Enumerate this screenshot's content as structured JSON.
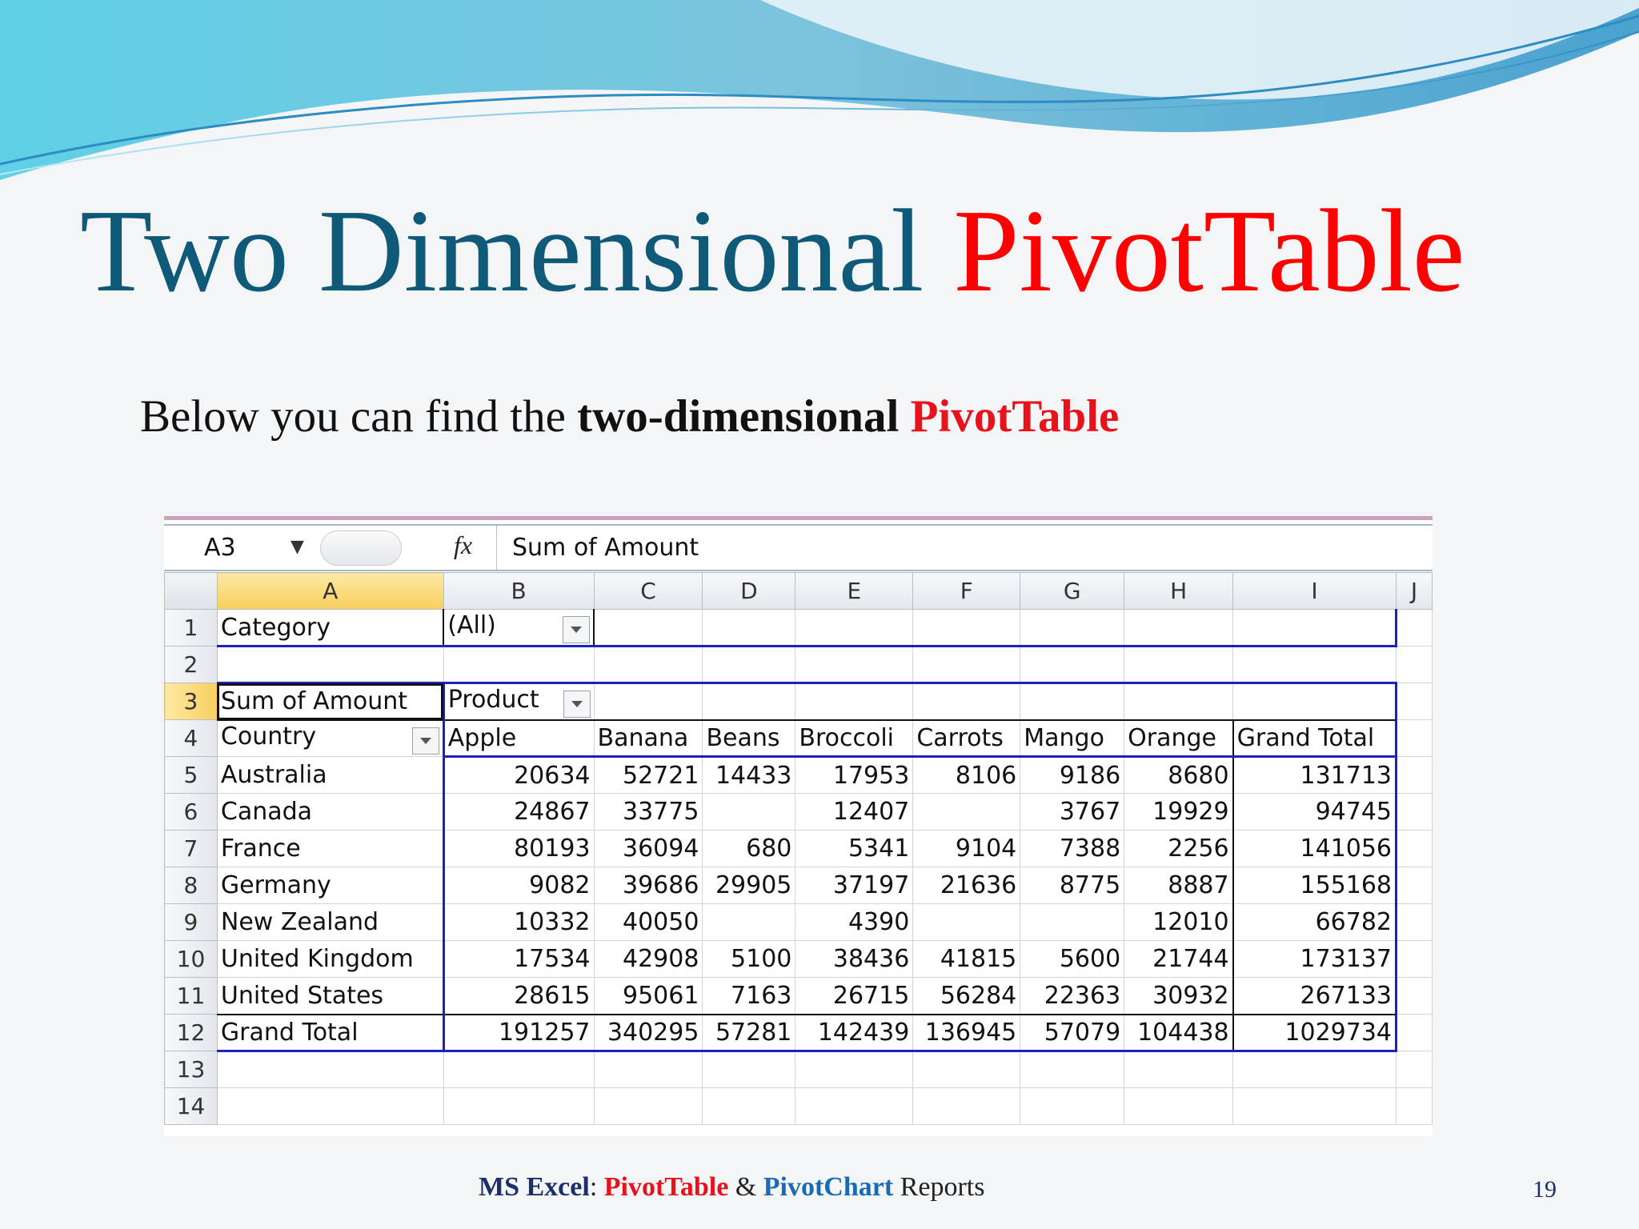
{
  "slide": {
    "title_part1": "Two Dimensional ",
    "title_part2": "PivotTable",
    "subtitle_part1": "Below you can find the ",
    "subtitle_bold": "two-dimensional ",
    "subtitle_red": "PivotTable"
  },
  "excel": {
    "name_box": "A3",
    "formula": "Sum of Amount",
    "fx_label": "fx",
    "columns": [
      "A",
      "B",
      "C",
      "D",
      "E",
      "F",
      "G",
      "H",
      "I",
      "J"
    ],
    "row_numbers": [
      "1",
      "2",
      "3",
      "4",
      "5",
      "6",
      "7",
      "8",
      "9",
      "10",
      "11",
      "12",
      "13",
      "14"
    ],
    "filter_label": "Category",
    "filter_value": "(All)",
    "values_label": "Sum of Amount",
    "col_field": "Product",
    "row_field": "Country",
    "products": [
      "Apple",
      "Banana",
      "Beans",
      "Broccoli",
      "Carrots",
      "Mango",
      "Orange",
      "Grand Total"
    ],
    "rows": [
      {
        "country": "Australia",
        "values": [
          "20634",
          "52721",
          "14433",
          "17953",
          "8106",
          "9186",
          "8680",
          "131713"
        ]
      },
      {
        "country": "Canada",
        "values": [
          "24867",
          "33775",
          "",
          "12407",
          "",
          "3767",
          "19929",
          "94745"
        ]
      },
      {
        "country": "France",
        "values": [
          "80193",
          "36094",
          "680",
          "5341",
          "9104",
          "7388",
          "2256",
          "141056"
        ]
      },
      {
        "country": "Germany",
        "values": [
          "9082",
          "39686",
          "29905",
          "37197",
          "21636",
          "8775",
          "8887",
          "155168"
        ]
      },
      {
        "country": "New Zealand",
        "values": [
          "10332",
          "40050",
          "",
          "4390",
          "",
          "",
          "12010",
          "66782"
        ]
      },
      {
        "country": "United Kingdom",
        "values": [
          "17534",
          "42908",
          "5100",
          "38436",
          "41815",
          "5600",
          "21744",
          "173137"
        ]
      },
      {
        "country": "United States",
        "values": [
          "28615",
          "95061",
          "7163",
          "26715",
          "56284",
          "22363",
          "30932",
          "267133"
        ]
      }
    ],
    "grand_total": {
      "label": "Grand Total",
      "values": [
        "191257",
        "340295",
        "57281",
        "142439",
        "136945",
        "57079",
        "104438",
        "1029734"
      ]
    }
  },
  "footer": {
    "part1": "MS Excel",
    "sep": ": ",
    "part2": "PivotTable",
    "amp": " & ",
    "part3": "PivotChart",
    "part4": " Reports",
    "page": "19"
  }
}
